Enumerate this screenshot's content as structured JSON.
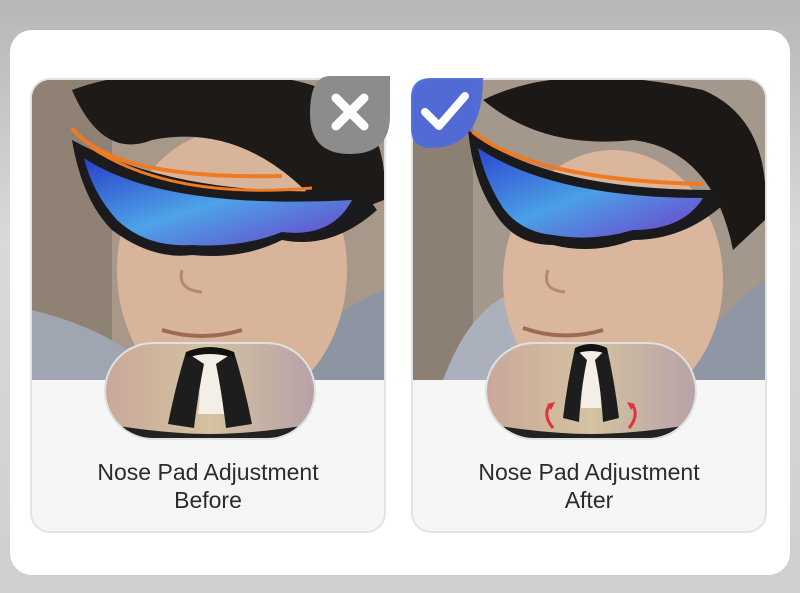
{
  "cards": [
    {
      "line1": "Nose Pad Adjustment",
      "line2": "Before",
      "badge": "x-mark-icon"
    },
    {
      "line1": "Nose Pad Adjustment",
      "line2": "After",
      "badge": "checkmark-icon"
    }
  ],
  "colors": {
    "accent_orange": "#f07a22",
    "lens_blue": "#3a5bd6",
    "badge_gray": "#8c8c8c",
    "badge_blue": "#4f68d8",
    "adjust_red": "#e0343c"
  }
}
